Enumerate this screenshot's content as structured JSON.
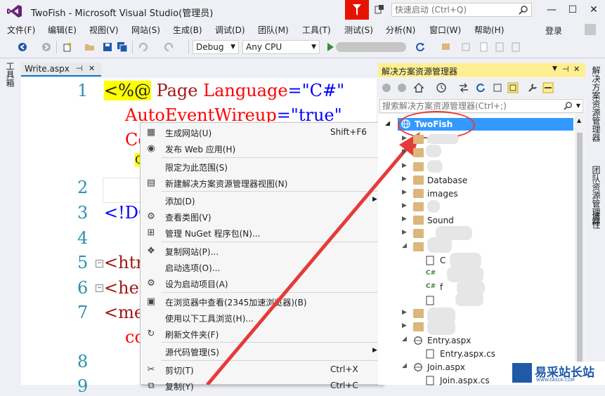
{
  "title_bar": {
    "title": "TwoFish - Microsoft Visual Studio(管理员)",
    "quick_launch_placeholder": "快速启动 (Ctrl+Q)",
    "minimize": "—",
    "maximize": "☐",
    "close": "✕"
  },
  "menu": {
    "items": [
      "文件(F)",
      "编辑(E)",
      "视图(V)",
      "网站(S)",
      "生成(B)",
      "调试(D)",
      "团队(M)",
      "工具(T)",
      "测试(S)",
      "分析(N)",
      "窗口(W)",
      "帮助(H)"
    ],
    "login": "登录"
  },
  "toolbar": {
    "config": "Debug",
    "platform": "Any CPU"
  },
  "left_strip": {
    "toolbox": "工具箱"
  },
  "editor": {
    "tab_label": "Write.aspx",
    "tab_pin": "⊣",
    "tab_close": "✕",
    "line_numbers": [
      "1",
      "2",
      "3",
      "4",
      "5",
      "6",
      "7",
      "8",
      "9"
    ],
    "line1_delim": "<%",
    "line1_at": "@",
    "line1_page": " Page ",
    "line1_attr1": "Language",
    "line1_eq1": "=",
    "line1_val1": "\"C#\"",
    "line1b_attr": "AutoEventWireup",
    "line1b_eq": "=",
    "line1b_val": "\"true\"",
    "line1c": "Co",
    "line1d": "C",
    "line3": "<!DO",
    "line5": "<htm",
    "line6": "<hea",
    "line7": "<met",
    "line7b": "co"
  },
  "context_menu": {
    "items": [
      {
        "icon": "build-icon",
        "glyph": "▦",
        "label": "生成网站(U)",
        "shortcut": "Shift+F6"
      },
      {
        "icon": "publish-icon",
        "glyph": "◉",
        "label": "发布 Web 应用(H)",
        "shortcut": ""
      },
      {
        "icon": "",
        "glyph": "",
        "label": "限定为此范围(S)",
        "shortcut": ""
      },
      {
        "icon": "new-view-icon",
        "glyph": "▤",
        "label": "新建解决方案资源管理器视图(N)",
        "shortcut": ""
      },
      {
        "icon": "",
        "glyph": "",
        "label": "添加(D)",
        "shortcut": ""
      },
      {
        "icon": "class-view-icon",
        "glyph": "⚙",
        "label": "查看类图(V)",
        "shortcut": ""
      },
      {
        "icon": "nuget-icon",
        "glyph": "⊞",
        "label": "管理 NuGet 程序包(N)...",
        "shortcut": ""
      },
      {
        "icon": "copy-site-icon",
        "glyph": "❖",
        "label": "复制网站(P)...",
        "shortcut": ""
      },
      {
        "icon": "",
        "glyph": "",
        "label": "启动选项(O)...",
        "shortcut": ""
      },
      {
        "icon": "gear-icon",
        "glyph": "⚙",
        "label": "设为启动项目(A)",
        "shortcut": ""
      },
      {
        "icon": "browser-icon",
        "glyph": "▣",
        "label": "在浏览器中查看(2345加速浏览器)(B)",
        "shortcut": ""
      },
      {
        "icon": "",
        "glyph": "",
        "label": "使用以下工具浏览(H)...",
        "shortcut": ""
      },
      {
        "icon": "refresh-icon",
        "glyph": "↻",
        "label": "刷新文件夹(F)",
        "shortcut": ""
      },
      {
        "icon": "",
        "glyph": "",
        "label": "源代码管理(S)",
        "shortcut": ""
      },
      {
        "icon": "cut-icon",
        "glyph": "✂",
        "label": "剪切(T)",
        "shortcut": "Ctrl+X"
      },
      {
        "icon": "copy-icon",
        "glyph": "⧉",
        "label": "复制(Y)",
        "shortcut": "Ctrl+C"
      }
    ]
  },
  "solution_explorer": {
    "title": "解决方案资源管理器",
    "search_placeholder": "搜索解决方案资源管理器(Ctrl+;)",
    "root": "TwoFish",
    "nodes": [
      {
        "label": "ad",
        "type": "folder"
      },
      {
        "label": "",
        "type": "folder"
      },
      {
        "label": "",
        "type": "folder"
      },
      {
        "label": "Database",
        "type": "folder"
      },
      {
        "label": "images",
        "type": "folder"
      },
      {
        "label": "",
        "type": "folder"
      },
      {
        "label": "Sound",
        "type": "folder"
      },
      {
        "label": "",
        "type": "folder"
      },
      {
        "label": "",
        "type": "folder"
      },
      {
        "label": "C",
        "type": "file"
      },
      {
        "label": "",
        "type": "cs"
      },
      {
        "label": "f",
        "type": "cs"
      },
      {
        "label": "",
        "type": "file"
      },
      {
        "label": "",
        "type": "folder"
      },
      {
        "label": "",
        "type": "folder"
      },
      {
        "label": "Entry.aspx",
        "type": "aspx"
      },
      {
        "label": "Entry.aspx.cs",
        "type": "file"
      },
      {
        "label": "Join.aspx",
        "type": "aspx"
      },
      {
        "label": "Join.aspx.cs",
        "type": "file"
      }
    ]
  },
  "right_strip": {
    "tab1": "解决方案资源管理器",
    "tab2": "团队资源管理器",
    "tab3": "属性"
  },
  "watermark": {
    "text": "易采站长站",
    "url": "WWW.EASCK.COM"
  }
}
